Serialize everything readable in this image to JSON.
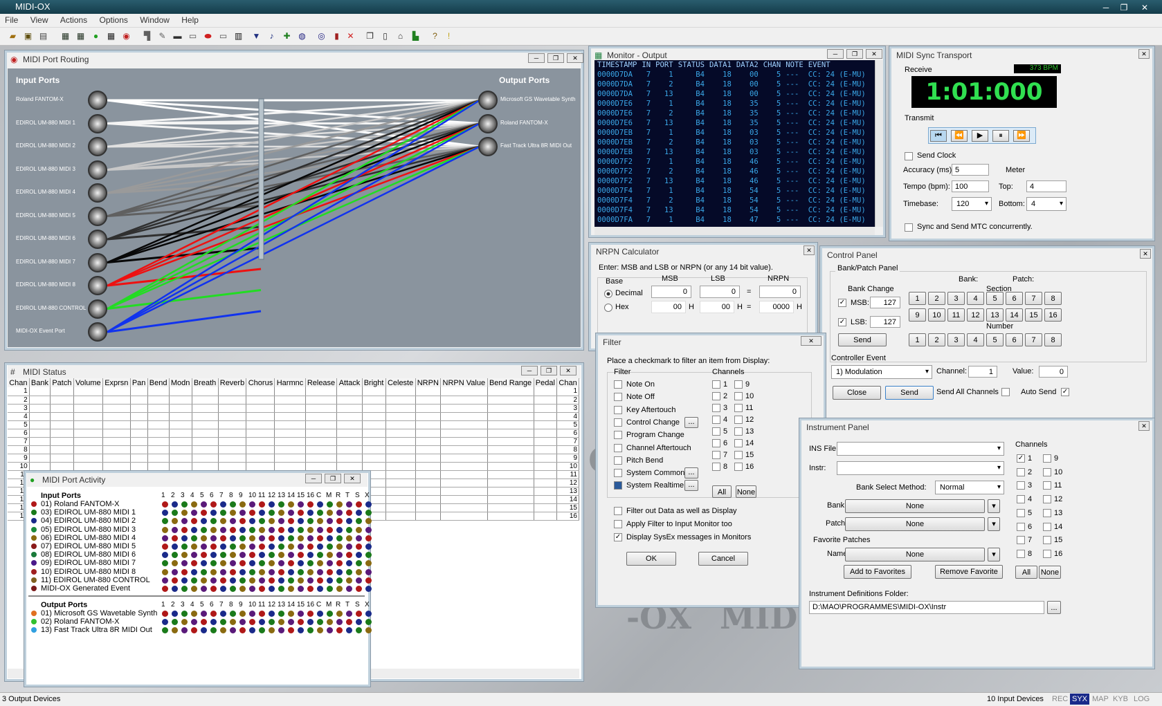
{
  "app": {
    "title": "MIDI-OX"
  },
  "menu": [
    "File",
    "View",
    "Actions",
    "Options",
    "Window",
    "Help"
  ],
  "routing": {
    "title": "MIDI Port Routing",
    "input_header": "Input Ports",
    "output_header": "Output Ports",
    "inputs": [
      "Roland FANTOM-X",
      "EDIROL UM-880 MIDI 1",
      "EDIROL UM-880 MIDI 2",
      "EDIROL UM-880 MIDI 3",
      "EDIROL UM-880 MIDI 4",
      "EDIROL UM-880 MIDI 5",
      "EDIROL UM-880 MIDI 6",
      "EDIROL UM-880 MIDI 7",
      "EDIROL UM-880 MIDI 8",
      "EDIROL UM-880 CONTROL",
      "MIDI-OX Event Port"
    ],
    "outputs": [
      "Microsoft GS Wavetable Synth",
      "Roland FANTOM-X",
      "Fast Track Ultra 8R MIDI Out"
    ],
    "line_colors": [
      "#ffffff",
      "#f4f4f4",
      "#e0e0e0",
      "#c8c8c8",
      "#9a9a9a",
      "#606060",
      "#303030",
      "#080808",
      "#ee1111",
      "#22dd22",
      "#1133ee"
    ]
  },
  "monitor": {
    "title": "Monitor - Output",
    "headers": [
      "TIMESTAMP",
      "IN",
      "PORT",
      "STATUS",
      "DATA1",
      "DATA2",
      "CHAN",
      "NOTE",
      "EVENT"
    ],
    "rows": [
      [
        "0000D7DA",
        "7",
        "1",
        "B4",
        "18",
        "00",
        "5",
        "---",
        "CC: 24 (E-MU)"
      ],
      [
        "0000D7DA",
        "7",
        "2",
        "B4",
        "18",
        "00",
        "5",
        "---",
        "CC: 24 (E-MU)"
      ],
      [
        "0000D7DA",
        "7",
        "13",
        "B4",
        "18",
        "00",
        "5",
        "---",
        "CC: 24 (E-MU)"
      ],
      [
        "0000D7E6",
        "7",
        "1",
        "B4",
        "18",
        "35",
        "5",
        "---",
        "CC: 24 (E-MU)"
      ],
      [
        "0000D7E6",
        "7",
        "2",
        "B4",
        "18",
        "35",
        "5",
        "---",
        "CC: 24 (E-MU)"
      ],
      [
        "0000D7E6",
        "7",
        "13",
        "B4",
        "18",
        "35",
        "5",
        "---",
        "CC: 24 (E-MU)"
      ],
      [
        "0000D7EB",
        "7",
        "1",
        "B4",
        "18",
        "03",
        "5",
        "---",
        "CC: 24 (E-MU)"
      ],
      [
        "0000D7EB",
        "7",
        "2",
        "B4",
        "18",
        "03",
        "5",
        "---",
        "CC: 24 (E-MU)"
      ],
      [
        "0000D7EB",
        "7",
        "13",
        "B4",
        "18",
        "03",
        "5",
        "---",
        "CC: 24 (E-MU)"
      ],
      [
        "0000D7F2",
        "7",
        "1",
        "B4",
        "18",
        "46",
        "5",
        "---",
        "CC: 24 (E-MU)"
      ],
      [
        "0000D7F2",
        "7",
        "2",
        "B4",
        "18",
        "46",
        "5",
        "---",
        "CC: 24 (E-MU)"
      ],
      [
        "0000D7F2",
        "7",
        "13",
        "B4",
        "18",
        "46",
        "5",
        "---",
        "CC: 24 (E-MU)"
      ],
      [
        "0000D7F4",
        "7",
        "1",
        "B4",
        "18",
        "54",
        "5",
        "---",
        "CC: 24 (E-MU)"
      ],
      [
        "0000D7F4",
        "7",
        "2",
        "B4",
        "18",
        "54",
        "5",
        "---",
        "CC: 24 (E-MU)"
      ],
      [
        "0000D7F4",
        "7",
        "13",
        "B4",
        "18",
        "54",
        "5",
        "---",
        "CC: 24 (E-MU)"
      ],
      [
        "0000D7FA",
        "7",
        "1",
        "B4",
        "18",
        "47",
        "5",
        "---",
        "CC: 24 (E-MU)"
      ]
    ]
  },
  "sync": {
    "title": "MIDI Sync Transport",
    "receive": "Receive",
    "bpm": "373 BPM",
    "time": "1:01:000",
    "transmit": "Transmit",
    "send_clock": "Send Clock",
    "accuracy_label": "Accuracy (ms):",
    "accuracy": "5",
    "meter": "Meter",
    "tempo_label": "Tempo (bpm):",
    "tempo": "100",
    "top_label": "Top:",
    "top": "4",
    "timebase_label": "Timebase:",
    "timebase": "120",
    "bottom_label": "Bottom:",
    "bottom": "4",
    "mtc": "Sync and Send MTC concurrently."
  },
  "nrpn": {
    "title": "NRPN Calculator",
    "instructions": "Enter: MSB and LSB or NRPN (or any 14 bit value).",
    "base": "Base",
    "decimal": "Decimal",
    "hex": "Hex",
    "msb": "MSB",
    "lsb": "LSB",
    "nrpn": "NRPN",
    "msb_dec": "0",
    "lsb_dec": "0",
    "eq": "=",
    "nrpn_dec": "0",
    "msb_hex": "00",
    "lsb_hex": "00",
    "nrpn_hex": "0000",
    "h": "H"
  },
  "control": {
    "title": "Control Panel",
    "bank_patch": "Bank/Patch Panel",
    "bank": "Bank:",
    "patch": "Patch:",
    "bank_change": "Bank Change",
    "section": "Section",
    "number": "Number",
    "msb": "MSB:",
    "msb_val": "127",
    "lsb": "LSB:",
    "lsb_val": "127",
    "send": "Send",
    "section_btns": [
      "1",
      "2",
      "3",
      "4",
      "5",
      "6",
      "7",
      "8",
      "9",
      "10",
      "11",
      "12",
      "13",
      "14",
      "15",
      "16"
    ],
    "number_btns": [
      "1",
      "2",
      "3",
      "4",
      "5",
      "6",
      "7",
      "8"
    ],
    "controller_event": "Controller Event",
    "controller": "1)  Modulation",
    "channel_label": "Channel:",
    "channel": "1",
    "value_label": "Value:",
    "value": "0",
    "close": "Close",
    "send2": "Send",
    "send_all": "Send All Channels",
    "auto_send": "Auto Send"
  },
  "filter": {
    "title": "Filter",
    "instructions": "Place a checkmark to filter an item from Display:",
    "filter": "Filter",
    "channels": "Channels",
    "items": [
      "Note On",
      "Note Off",
      "Key Aftertouch",
      "Control Change",
      "Program Change",
      "Channel Aftertouch",
      "Pitch Bend",
      "System Common",
      "System Realtime"
    ],
    "ch_left": [
      "1",
      "2",
      "3",
      "4",
      "5",
      "6",
      "7",
      "8"
    ],
    "ch_right": [
      "9",
      "10",
      "11",
      "12",
      "13",
      "14",
      "15",
      "16"
    ],
    "all": "All",
    "none": "None",
    "dots": "...",
    "opt1": "Filter out Data as well as Display",
    "opt2": "Apply Filter to Input Monitor too",
    "opt3": "Display SysEx messages in Monitors",
    "ok": "OK",
    "cancel": "Cancel"
  },
  "instrument": {
    "title": "Instrument Panel",
    "ins_file": "INS File:",
    "instr": "Instr:",
    "bank_method_label": "Bank Select Method:",
    "bank_method": "Normal",
    "bank_label": "Bank:",
    "bank": "None",
    "patch_label": "Patch:",
    "patch": "None",
    "favorites": "Favorite Patches",
    "name_label": "Name:",
    "name": "None",
    "add_fav": "Add to Favorites",
    "remove_fav": "Remove Favorite",
    "channels": "Channels",
    "ch_left": [
      "1",
      "2",
      "3",
      "4",
      "5",
      "6",
      "7",
      "8"
    ],
    "ch_right": [
      "9",
      "10",
      "11",
      "12",
      "13",
      "14",
      "15",
      "16"
    ],
    "all": "All",
    "none": "None",
    "folder_label": "Instrument Definitions Folder:",
    "folder": "D:\\MAO\\PROGRAMMES\\MIDI-OX\\Instr",
    "browse": "..."
  },
  "status_win": {
    "title": "MIDI Status",
    "columns": [
      "Chan",
      "Bank",
      "Patch",
      "Volume",
      "Exprsn",
      "Pan",
      "Bend",
      "Modn",
      "Breath",
      "Reverb",
      "Chorus",
      "Harmnc",
      "Release",
      "Attack",
      "Bright",
      "Celeste",
      "NRPN",
      "NRPN Value",
      "Bend Range",
      "Pedal",
      "Chan"
    ],
    "rows": [
      "1",
      "2",
      "3",
      "4",
      "5",
      "6",
      "7",
      "8",
      "9",
      "10",
      "11",
      "12",
      "13",
      "14",
      "15",
      "16"
    ]
  },
  "activity": {
    "title": "MIDI Port Activity",
    "input_header": "Input Ports",
    "ch_header": [
      "1",
      "2",
      "3",
      "4",
      "5",
      "6",
      "7",
      "8",
      "9",
      "10",
      "11",
      "12",
      "13",
      "14",
      "15",
      "16",
      "C",
      "M",
      "R",
      "T",
      "S",
      "X"
    ],
    "inputs": [
      "01) Roland FANTOM-X",
      "03) EDIROL UM-880 MIDI 1",
      "04) EDIROL UM-880 MIDI 2",
      "05) EDIROL UM-880 MIDI 3",
      "06) EDIROL UM-880 MIDI 4",
      "07) EDIROL UM-880 MIDI 5",
      "08) EDIROL UM-880 MIDI 6",
      "09) EDIROL UM-880 MIDI 7",
      "10) EDIROL UM-880 MIDI 8",
      "11) EDIROL UM-880 CONTROL",
      "MIDI-OX Generated Event"
    ],
    "input_colors": [
      "#b01818",
      "#1a7a1a",
      "#1a2a8a",
      "#1a8a3a",
      "#8a6a10",
      "#8a1a1a",
      "#1a7a3a",
      "#4a1a8a",
      "#a02020",
      "#806020",
      "#7a1a1a"
    ],
    "output_header": "Output Ports",
    "outputs": [
      "01) Microsoft GS Wavetable Synth",
      "02) Roland FANTOM-X",
      "13) Fast Track Ultra 8R MIDI Out"
    ],
    "output_colors": [
      "#e07020",
      "#30c030",
      "#30a0e0"
    ]
  },
  "statusbar": {
    "left": "3 Output Devices",
    "right": "10 Input Devices",
    "flags": [
      "REC",
      "SYX",
      "MAP",
      "KYB",
      "LOG"
    ]
  },
  "watermark": "MIDI-OX"
}
